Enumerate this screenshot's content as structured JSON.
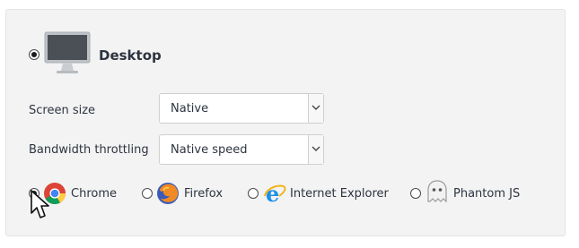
{
  "platform": {
    "label": "Desktop",
    "selected": true,
    "icon": "monitor-icon"
  },
  "settings": {
    "screen_size": {
      "label": "Screen size",
      "value": "Native"
    },
    "bandwidth": {
      "label": "Bandwidth throttling",
      "value": "Native speed"
    }
  },
  "browsers": [
    {
      "label": "Chrome",
      "icon": "chrome-icon",
      "selected": true
    },
    {
      "label": "Firefox",
      "icon": "firefox-icon",
      "selected": false
    },
    {
      "label": "Internet Explorer",
      "icon": "internet-explorer-icon",
      "selected": false
    },
    {
      "label": "Phantom JS",
      "icon": "phantom-js-icon",
      "selected": false
    }
  ],
  "colors": {
    "panel_bg": "#f3f3f3",
    "text": "#2d3440",
    "ie_blue": "#1e90e6"
  }
}
